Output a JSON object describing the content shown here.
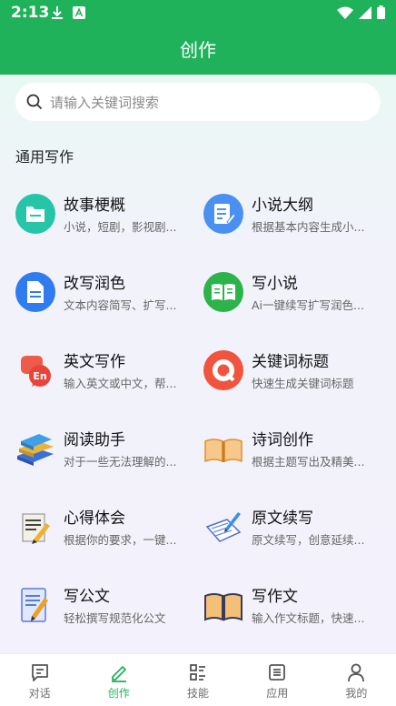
{
  "status_bar": {
    "time": "2:13"
  },
  "header": {
    "title": "创作"
  },
  "search": {
    "placeholder": "请输入关键词搜索"
  },
  "section": {
    "title": "通用写作"
  },
  "items": [
    {
      "title": "故事梗概",
      "desc": "小说，短剧，影视剧...",
      "icon": "folder-icon"
    },
    {
      "title": "小说大纲",
      "desc": "根据基本内容生成小...",
      "icon": "document-edit-icon"
    },
    {
      "title": "改写润色",
      "desc": "文本内容简写、扩写...",
      "icon": "document-icon"
    },
    {
      "title": "写小说",
      "desc": "Ai一键续写扩写润色...",
      "icon": "open-book-icon"
    },
    {
      "title": "英文写作",
      "desc": "输入英文或中文，帮...",
      "icon": "english-bubble-icon"
    },
    {
      "title": "关键词标题",
      "desc": "快速生成关键词标题",
      "icon": "q-ring-icon"
    },
    {
      "title": "阅读助手",
      "desc": "对于一些无法理解的...",
      "icon": "book-stack-icon"
    },
    {
      "title": "诗词创作",
      "desc": "根据主题写出及精美...",
      "icon": "open-book-orange-icon"
    },
    {
      "title": "心得体会",
      "desc": "根据你的要求，一键...",
      "icon": "notepad-pencil-icon"
    },
    {
      "title": "原文续写",
      "desc": "原文续写，创意延续...",
      "icon": "notebook-pen-icon"
    },
    {
      "title": "写公文",
      "desc": "轻松撰写规范化公文",
      "icon": "document-pencil-icon"
    },
    {
      "title": "写作文",
      "desc": "输入作文标题，快速...",
      "icon": "reading-book-icon"
    }
  ],
  "tabbar": {
    "tabs": [
      {
        "label": "对话",
        "icon": "chat-icon",
        "active": false
      },
      {
        "label": "创作",
        "icon": "pencil-icon",
        "active": true
      },
      {
        "label": "技能",
        "icon": "skills-list-icon",
        "active": false
      },
      {
        "label": "应用",
        "icon": "apps-list-icon",
        "active": false
      },
      {
        "label": "我的",
        "icon": "user-icon",
        "active": false
      }
    ]
  },
  "colors": {
    "brand": "#1fb25a",
    "background": "#f6f5fb"
  }
}
